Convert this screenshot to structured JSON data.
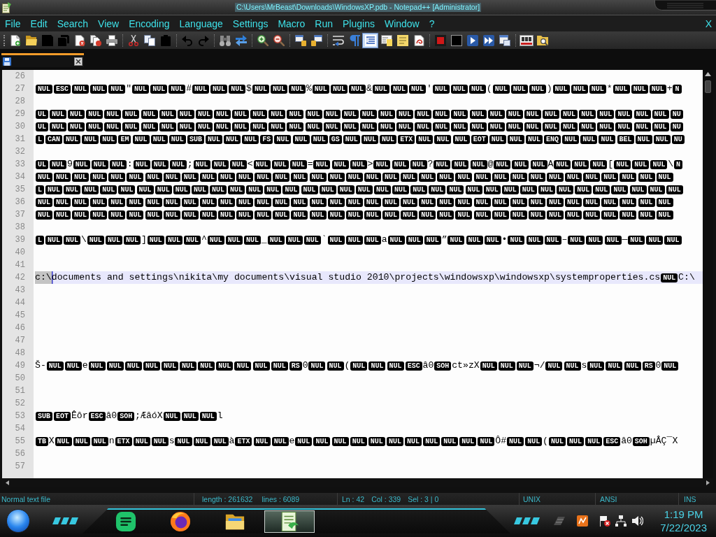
{
  "window": {
    "title": "C:\\Users\\MrBeast\\Downloads\\WindowsXP.pdb - Notepad++ [Administrator]"
  },
  "menu": {
    "items": [
      "File",
      "Edit",
      "Search",
      "View",
      "Encoding",
      "Language",
      "Settings",
      "Macro",
      "Run",
      "Plugins",
      "Window",
      "?"
    ],
    "close": "X"
  },
  "toolbar": [
    [
      {
        "kind": "new",
        "pressed": false
      },
      {
        "kind": "open",
        "pressed": false
      },
      {
        "kind": "save",
        "pressed": false
      },
      {
        "kind": "save-all",
        "pressed": false
      },
      {
        "kind": "close",
        "pressed": false
      },
      {
        "kind": "close-all",
        "pressed": false
      },
      {
        "kind": "print",
        "pressed": false
      }
    ],
    [
      {
        "kind": "cut",
        "pressed": false
      },
      {
        "kind": "copy",
        "pressed": false
      },
      {
        "kind": "paste",
        "pressed": false
      }
    ],
    [
      {
        "kind": "undo",
        "pressed": false
      },
      {
        "kind": "redo",
        "pressed": false
      }
    ],
    [
      {
        "kind": "find",
        "pressed": false
      },
      {
        "kind": "replace",
        "pressed": false
      }
    ],
    [
      {
        "kind": "zoom-in",
        "pressed": false
      },
      {
        "kind": "zoom-out",
        "pressed": false
      }
    ],
    [
      {
        "kind": "sync-vertical",
        "pressed": false
      },
      {
        "kind": "sync-horizontal",
        "pressed": false
      }
    ],
    [
      {
        "kind": "wrap",
        "pressed": false
      },
      {
        "kind": "all-chars",
        "pressed": false
      },
      {
        "kind": "indent-guide",
        "pressed": true
      },
      {
        "kind": "doc-map",
        "pressed": false
      },
      {
        "kind": "function-list",
        "pressed": false
      },
      {
        "kind": "folder-workspace",
        "pressed": false
      }
    ],
    [
      {
        "kind": "record",
        "pressed": false
      },
      {
        "kind": "stop",
        "pressed": false
      },
      {
        "kind": "play",
        "pressed": false
      },
      {
        "kind": "play-multiple",
        "pressed": false
      },
      {
        "kind": "save-macro",
        "pressed": false
      }
    ],
    [
      {
        "kind": "spellcheck",
        "pressed": false
      },
      {
        "kind": "find-in-files",
        "pressed": false
      }
    ]
  ],
  "tabs": [
    {
      "selected": true
    }
  ],
  "editor": {
    "lines": [
      {
        "number": "26",
        "current": false
      },
      {
        "number": "27",
        "current": false,
        "segments": [
          {
            "kind": "ctrl",
            "text": "NUL ESC NUL NUL NUL"
          },
          {
            "kind": "text",
            "text": "\""
          },
          {
            "kind": "ctrl",
            "text": "NUL NUL NUL"
          },
          {
            "kind": "text",
            "text": "#"
          },
          {
            "kind": "ctrl",
            "text": "NUL NUL NUL"
          },
          {
            "kind": "text",
            "text": "$"
          },
          {
            "kind": "ctrl",
            "text": "NUL NUL NUL"
          },
          {
            "kind": "text",
            "text": "%"
          },
          {
            "kind": "ctrl",
            "text": "NUL NUL NUL"
          },
          {
            "kind": "text",
            "text": "&"
          },
          {
            "kind": "ctrl",
            "text": "NUL NUL NUL"
          },
          {
            "kind": "text",
            "text": "'"
          },
          {
            "kind": "ctrl",
            "text": "NUL NUL NUL"
          },
          {
            "kind": "text",
            "text": "("
          },
          {
            "kind": "ctrl",
            "text": "NUL NUL NUL"
          },
          {
            "kind": "text",
            "text": ")"
          },
          {
            "kind": "ctrl",
            "text": "NUL NUL NUL"
          },
          {
            "kind": "text",
            "text": "*"
          },
          {
            "kind": "ctrl",
            "text": "NUL NUL NUL"
          },
          {
            "kind": "text",
            "text": "+"
          },
          {
            "kind": "ctrl",
            "text": "N"
          }
        ]
      },
      {
        "number": "28",
        "current": false
      },
      {
        "number": "29",
        "current": false,
        "segments": [
          {
            "kind": "ctrl",
            "text": "UL NUL NUL NUL NUL NUL NUL NUL NUL NUL NUL NUL NUL NUL NUL NUL NUL NUL NUL NUL NUL NUL NUL NUL NUL NUL NUL NUL NUL NUL NUL NUL NUL NUL NUL NU"
          }
        ]
      },
      {
        "number": "30",
        "current": false,
        "segments": [
          {
            "kind": "ctrl",
            "text": "UL NUL NUL NUL NUL NUL NUL NUL NUL NUL NUL NUL NUL NUL NUL NUL NUL NUL NUL NUL NUL NUL NUL NUL NUL NUL NUL NUL NUL NUL NUL NUL NUL NUL NUL NU"
          }
        ]
      },
      {
        "number": "31",
        "current": false,
        "segments": [
          {
            "kind": "ctrl",
            "text": "L CAN NUL NUL NUL EM NUL NUL NUL SUB NUL NUL NUL FS NUL NUL NUL GS NUL NUL NUL ETX NUL NUL NUL EOT NUL NUL NUL ENQ NUL NUL NUL BEL NUL NUL NU"
          }
        ]
      },
      {
        "number": "32",
        "current": false
      },
      {
        "number": "33",
        "current": false,
        "segments": [
          {
            "kind": "ctrl",
            "text": "UL NUL"
          },
          {
            "kind": "text",
            "text": "9"
          },
          {
            "kind": "ctrl",
            "text": "NUL NUL NUL"
          },
          {
            "kind": "text",
            "text": ":"
          },
          {
            "kind": "ctrl",
            "text": "NUL NUL NUL"
          },
          {
            "kind": "text",
            "text": ";"
          },
          {
            "kind": "ctrl",
            "text": "NUL NUL NUL"
          },
          {
            "kind": "text",
            "text": "<"
          },
          {
            "kind": "ctrl",
            "text": "NUL NUL NUL"
          },
          {
            "kind": "text",
            "text": "="
          },
          {
            "kind": "ctrl",
            "text": "NUL NUL NUL"
          },
          {
            "kind": "text",
            "text": ">"
          },
          {
            "kind": "ctrl",
            "text": "NUL NUL NUL"
          },
          {
            "kind": "text",
            "text": "?"
          },
          {
            "kind": "ctrl",
            "text": "NUL NUL NUL"
          },
          {
            "kind": "text",
            "text": "@"
          },
          {
            "kind": "ctrl",
            "text": "NUL NUL NUL"
          },
          {
            "kind": "text",
            "text": "A"
          },
          {
            "kind": "ctrl",
            "text": "NUL NUL NUL"
          },
          {
            "kind": "text",
            "text": "["
          },
          {
            "kind": "ctrl",
            "text": "NUL NUL NUL"
          },
          {
            "kind": "text",
            "text": "\\"
          },
          {
            "kind": "ctrl",
            "text": "N"
          }
        ]
      },
      {
        "number": "34",
        "current": false,
        "segments": [
          {
            "kind": "ctrl",
            "text": "NUL NUL NUL NUL NUL NUL NUL NUL NUL NUL NUL NUL NUL NUL NUL NUL NUL NUL NUL NUL NUL NUL NUL NUL NUL NUL NUL NUL NUL NUL NUL NUL NUL NUL NUL"
          }
        ]
      },
      {
        "number": "35",
        "current": false,
        "segments": [
          {
            "kind": "ctrl",
            "text": "L NUL NUL NUL NUL NUL NUL NUL NUL NUL NUL NUL NUL NUL NUL NUL NUL NUL NUL NUL NUL NUL NUL NUL NUL NUL NUL NUL NUL NUL NUL NUL NUL NUL NUL NUL"
          }
        ]
      },
      {
        "number": "36",
        "current": false,
        "segments": [
          {
            "kind": "ctrl",
            "text": "NUL NUL NUL NUL NUL NUL NUL NUL NUL NUL NUL NUL NUL NUL NUL NUL NUL NUL NUL NUL NUL NUL NUL NUL NUL NUL NUL NUL NUL NUL NUL NUL NUL NUL NUL"
          }
        ]
      },
      {
        "number": "37",
        "current": false,
        "segments": [
          {
            "kind": "ctrl",
            "text": "NUL NUL NUL NUL NUL NUL NUL NUL NUL NUL NUL NUL NUL NUL NUL NUL NUL NUL NUL NUL NUL NUL NUL NUL NUL NUL NUL NUL NUL NUL NUL NUL NUL NUL NUL"
          }
        ]
      },
      {
        "number": "38",
        "current": false
      },
      {
        "number": "39",
        "current": false,
        "segments": [
          {
            "kind": "ctrl",
            "text": "L NUL NUL"
          },
          {
            "kind": "text",
            "text": "\\"
          },
          {
            "kind": "ctrl",
            "text": "NUL NUL NUL"
          },
          {
            "kind": "text",
            "text": "]"
          },
          {
            "kind": "ctrl",
            "text": "NUL NUL NUL"
          },
          {
            "kind": "text",
            "text": "^"
          },
          {
            "kind": "ctrl",
            "text": "NUL NUL NUL"
          },
          {
            "kind": "text",
            "text": "_"
          },
          {
            "kind": "ctrl",
            "text": "NUL NUL NUL"
          },
          {
            "kind": "text",
            "text": "`"
          },
          {
            "kind": "ctrl",
            "text": "NUL NUL NUL"
          },
          {
            "kind": "text",
            "text": "a"
          },
          {
            "kind": "ctrl",
            "text": "NUL NUL NUL"
          },
          {
            "kind": "text",
            "text": "”"
          },
          {
            "kind": "ctrl",
            "text": "NUL NUL NUL"
          },
          {
            "kind": "text",
            "text": "•"
          },
          {
            "kind": "ctrl",
            "text": "NUL NUL NUL"
          },
          {
            "kind": "text",
            "text": "–"
          },
          {
            "kind": "ctrl",
            "text": "NUL NUL NUL"
          },
          {
            "kind": "text",
            "text": "—"
          },
          {
            "kind": "ctrl",
            "text": "NUL NUL NUL"
          }
        ]
      },
      {
        "number": "40",
        "current": false
      },
      {
        "number": "41",
        "current": false
      },
      {
        "number": "42",
        "current": true,
        "segments": [
          {
            "kind": "selected",
            "text": "c:\\"
          },
          {
            "kind": "text",
            "text": "documents and settings\\nikita\\my documents\\visual studio 2010\\projects\\windowsxp\\windowsxp\\systemproperties.cs"
          },
          {
            "kind": "ctrl",
            "text": "NUL"
          },
          {
            "kind": "text",
            "text": "C:\\"
          }
        ]
      },
      {
        "number": "43",
        "current": false
      },
      {
        "number": "44",
        "current": false
      },
      {
        "number": "45",
        "current": false
      },
      {
        "number": "46",
        "current": false
      },
      {
        "number": "47",
        "current": false
      },
      {
        "number": "48",
        "current": false
      },
      {
        "number": "49",
        "current": false,
        "segments": [
          {
            "kind": "text",
            "text": "Š-"
          },
          {
            "kind": "ctrl",
            "text": "NUL NUL"
          },
          {
            "kind": "text",
            "text": "e"
          },
          {
            "kind": "ctrl",
            "text": "NUL NUL NUL NUL NUL NUL NUL NUL NUL NUL NUL RS"
          },
          {
            "kind": "text",
            "text": "0"
          },
          {
            "kind": "ctrl",
            "text": "NUL NUL"
          },
          {
            "kind": "text",
            "text": "("
          },
          {
            "kind": "ctrl",
            "text": "NUL NUL NUL ESC"
          },
          {
            "kind": "text",
            "text": "â0"
          },
          {
            "kind": "ctrl",
            "text": "SOH"
          },
          {
            "kind": "text",
            "text": "ct»zX"
          },
          {
            "kind": "ctrl",
            "text": "NUL NUL NUL"
          },
          {
            "kind": "text",
            "text": "¬/"
          },
          {
            "kind": "ctrl",
            "text": "NUL NUL"
          },
          {
            "kind": "text",
            "text": "s"
          },
          {
            "kind": "ctrl",
            "text": "NUL NUL NUL RS"
          },
          {
            "kind": "text",
            "text": "0"
          },
          {
            "kind": "ctrl",
            "text": "NUL"
          }
        ]
      },
      {
        "number": "50",
        "current": false
      },
      {
        "number": "51",
        "current": false
      },
      {
        "number": "52",
        "current": false
      },
      {
        "number": "53",
        "current": false,
        "segments": [
          {
            "kind": "ctrl",
            "text": "SUB EOT"
          },
          {
            "kind": "text",
            "text": "Êôr"
          },
          {
            "kind": "ctrl",
            "text": "ESC"
          },
          {
            "kind": "text",
            "text": "â0"
          },
          {
            "kind": "ctrl",
            "text": "SOH"
          },
          {
            "kind": "text",
            "text": ";ÆâóX"
          },
          {
            "kind": "ctrl",
            "text": "NUL NUL NUL"
          },
          {
            "kind": "text",
            "text": "l"
          }
        ]
      },
      {
        "number": "54",
        "current": false
      },
      {
        "number": "55",
        "current": false,
        "segments": [
          {
            "kind": "ctrl",
            "text": "TB"
          },
          {
            "kind": "text",
            "text": "X"
          },
          {
            "kind": "ctrl",
            "text": "NUL NUL NUL"
          },
          {
            "kind": "text",
            "text": "n"
          },
          {
            "kind": "ctrl",
            "text": "ETX NUL NUL"
          },
          {
            "kind": "text",
            "text": "s"
          },
          {
            "kind": "ctrl",
            "text": "NUL NUL NUL"
          },
          {
            "kind": "text",
            "text": "à"
          },
          {
            "kind": "ctrl",
            "text": "ETX NUL NUL"
          },
          {
            "kind": "text",
            "text": "e"
          },
          {
            "kind": "ctrl",
            "text": "NUL NUL NUL NUL NUL NUL NUL NUL NUL NUL NUL"
          },
          {
            "kind": "text",
            "text": "Ô#"
          },
          {
            "kind": "ctrl",
            "text": "NUL NUL"
          },
          {
            "kind": "text",
            "text": "("
          },
          {
            "kind": "ctrl",
            "text": "NUL NUL NUL ESC"
          },
          {
            "kind": "text",
            "text": "â0"
          },
          {
            "kind": "ctrl",
            "text": "SOH"
          },
          {
            "kind": "text",
            "text": "µÂÇ¯X"
          }
        ]
      },
      {
        "number": "56",
        "current": false
      },
      {
        "number": "57",
        "current": false
      }
    ]
  },
  "status_bar": {
    "file_type": "Normal text file",
    "length": "length : 261632",
    "lines": "lines : 6089",
    "line": "Ln : 42",
    "column": "Col : 339",
    "selection": "Sel : 3 | 0",
    "eol": "UNIX",
    "encoding": "ANSI",
    "mode": "INS"
  },
  "taskbar": {
    "apps": [
      {
        "kind": "chat",
        "selected": false
      },
      {
        "kind": "browser",
        "selected": false
      },
      {
        "kind": "files",
        "selected": false
      },
      {
        "kind": "editor",
        "selected": true
      }
    ],
    "clock": {
      "time": "1:19 PM",
      "date": "7/22/2023"
    }
  }
}
